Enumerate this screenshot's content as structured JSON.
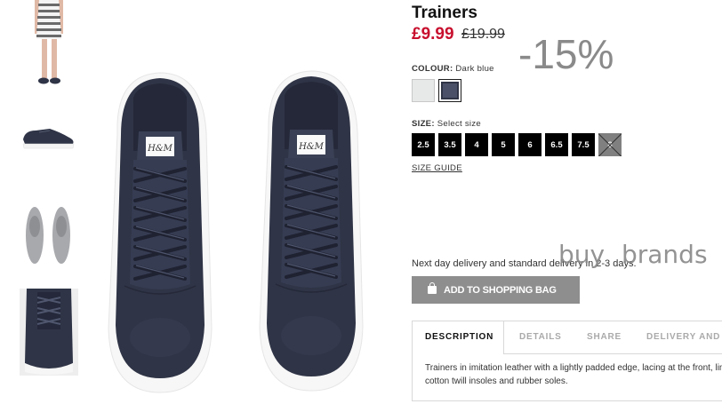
{
  "product": {
    "title": "Trainers",
    "price_now": "£9.99",
    "price_was": "£19.99",
    "discount_badge": "-15%"
  },
  "colour": {
    "label": "COLOUR:",
    "value": "Dark blue",
    "swatches": [
      {
        "name": "Light grey",
        "color": "#e7e9e9"
      },
      {
        "name": "Dark blue",
        "color": "#2f3446",
        "selected": true
      }
    ]
  },
  "size": {
    "label": "SIZE:",
    "hint": "Select size",
    "options": [
      "2.5",
      "3.5",
      "4",
      "5",
      "6",
      "6.5",
      "7.5",
      "8"
    ],
    "sold_out": [
      "8"
    ],
    "guide_label": "SIZE GUIDE"
  },
  "watermark": "buy brands",
  "delivery_text": "Next day delivery and standard delivery in 2-3 days.",
  "add_to_bag_label": "ADD TO SHOPPING BAG",
  "tabs": [
    "DESCRIPTION",
    "DETAILS",
    "SHARE",
    "DELIVERY AND"
  ],
  "description": "Trainers in imitation leather with a lightly padded edge, lacing at the front, linings, cotton twill insoles and rubber soles.",
  "main_image_brand": "H&M",
  "colors": {
    "price_red": "#c8102e",
    "shoe_navy": "#2f3446",
    "button_grey": "#8e8e8e"
  }
}
